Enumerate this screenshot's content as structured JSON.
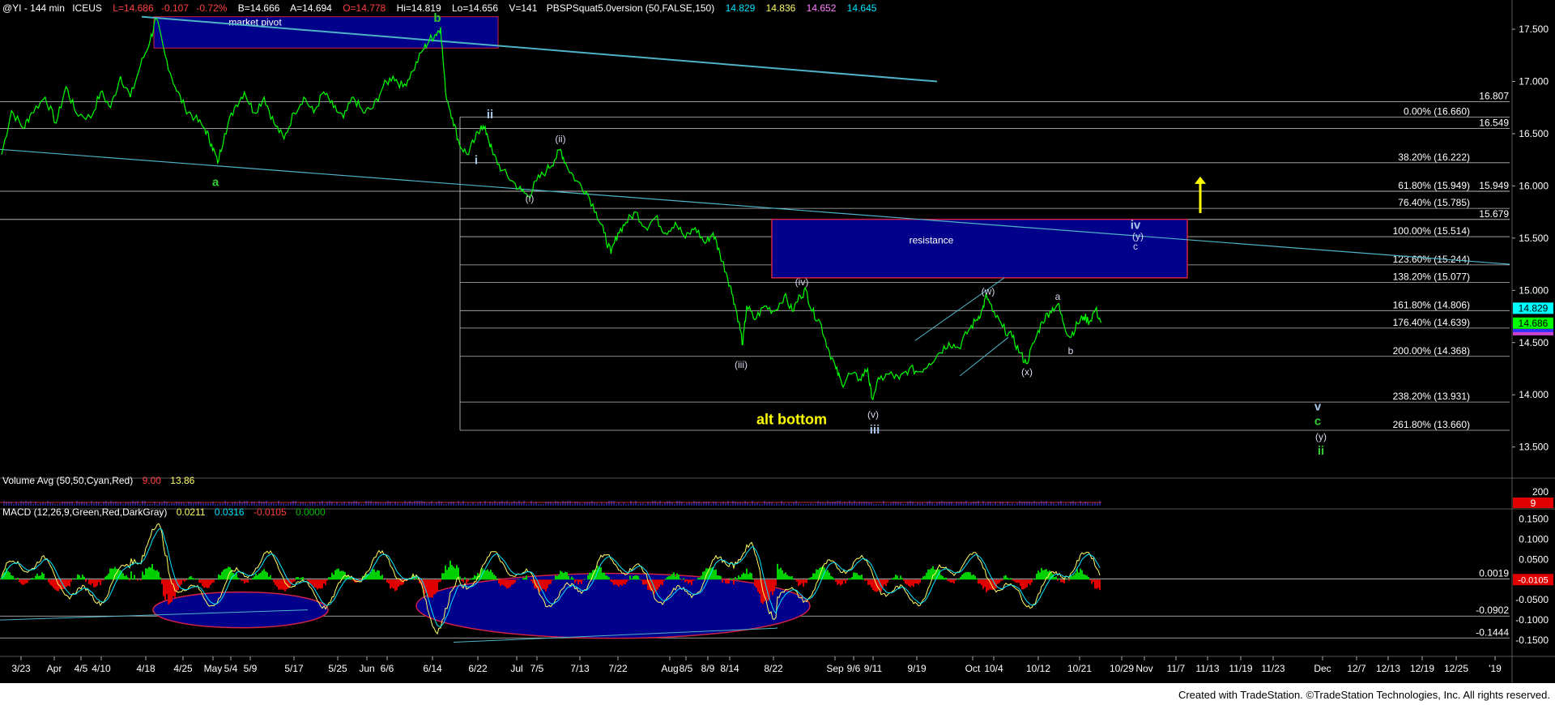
{
  "header": {
    "symbol": "@YI - 144 min",
    "exchange": "ICEUS",
    "last": "L=14.686",
    "change": "-0.107",
    "change_pct": "-0.72%",
    "bid": "B=14.666",
    "ask": "A=14.694",
    "open": "O=14.778",
    "high": "Hi=14.819",
    "low": "Lo=14.656",
    "volume": "V=141",
    "study": "PBSPSquat5.0version (50,FALSE,150)",
    "study_values": [
      "14.829",
      "14.836",
      "14.652",
      "14.645"
    ]
  },
  "colors": {
    "background": "#000000",
    "price": "#00ff00",
    "cyan_line": "#4fb3c8",
    "box_fill": "#00008b",
    "yellow": "#ffff00",
    "wave_green": "#33cc33",
    "wave_white": "#d8d8f0",
    "wave_lightblue": "#a8c8e8"
  },
  "volume_panel": {
    "title": "Volume Avg (50,50,Cyan,Red)",
    "value1": "9.00",
    "value2": "13.86",
    "axis_labels": [
      "200",
      "9"
    ]
  },
  "macd_panel": {
    "title": "MACD (12,26,9,Green,Red,DarkGray)",
    "values": [
      "0.0211",
      "0.0316",
      "-0.0105",
      "0.0000"
    ],
    "axis_ticks": [
      "0.1500",
      "0.1000",
      "0.0500",
      "-0.0500",
      "-0.1000",
      "-0.1500"
    ],
    "levels": [
      "0.0019",
      "-0.0902",
      "-0.1444"
    ],
    "last_value": "-0.0105"
  },
  "footer_text": "Created with TradeStation. ©TradeStation Technologies, Inc. All rights reserved.",
  "chart_data": {
    "type": "line",
    "title": "@YI - 144 min",
    "x_tick_labels": [
      "3/23",
      "Apr",
      "4/5",
      "4/10",
      "4/18",
      "4/25",
      "May",
      "5/4",
      "5/9",
      "5/17",
      "5/25",
      "Jun",
      "6/6",
      "6/14",
      "6/22",
      "Jul",
      "7/5",
      "7/13",
      "7/22",
      "Aug",
      "8/5",
      "8/9",
      "8/14",
      "8/22",
      "Sep",
      "9/6",
      "9/11",
      "9/19",
      "Oct",
      "10/4",
      "10/12",
      "10/21",
      "10/29",
      "Nov",
      "11/7",
      "11/13",
      "11/19",
      "11/23",
      "Dec",
      "12/7",
      "12/13",
      "12/19",
      "12/25",
      "'19"
    ],
    "y_ticks": [
      17.5,
      17.0,
      16.5,
      16.0,
      15.5,
      15.0,
      14.5,
      14.0,
      13.5
    ],
    "ylim": [
      13.28,
      17.78
    ],
    "price_series": {
      "name": "Price",
      "points": [
        [
          0,
          16.3
        ],
        [
          10,
          16.72
        ],
        [
          22,
          16.55
        ],
        [
          30,
          16.7
        ],
        [
          44,
          16.85
        ],
        [
          55,
          16.6
        ],
        [
          65,
          16.95
        ],
        [
          75,
          16.7
        ],
        [
          90,
          16.65
        ],
        [
          100,
          16.9
        ],
        [
          110,
          16.75
        ],
        [
          120,
          17.05
        ],
        [
          130,
          16.85
        ],
        [
          140,
          17.15
        ],
        [
          150,
          17.4
        ],
        [
          156,
          17.6
        ],
        [
          165,
          17.25
        ],
        [
          175,
          16.95
        ],
        [
          185,
          16.75
        ],
        [
          195,
          16.65
        ],
        [
          205,
          16.55
        ],
        [
          212,
          16.4
        ],
        [
          218,
          16.22
        ],
        [
          225,
          16.5
        ],
        [
          235,
          16.75
        ],
        [
          245,
          16.9
        ],
        [
          255,
          16.7
        ],
        [
          265,
          16.85
        ],
        [
          275,
          16.6
        ],
        [
          285,
          16.45
        ],
        [
          295,
          16.7
        ],
        [
          305,
          16.85
        ],
        [
          315,
          16.7
        ],
        [
          325,
          16.9
        ],
        [
          335,
          16.75
        ],
        [
          345,
          16.65
        ],
        [
          355,
          16.85
        ],
        [
          365,
          16.7
        ],
        [
          375,
          16.75
        ],
        [
          385,
          16.95
        ],
        [
          395,
          17.05
        ],
        [
          405,
          16.95
        ],
        [
          415,
          17.1
        ],
        [
          425,
          17.3
        ],
        [
          432,
          17.4
        ],
        [
          438,
          17.45
        ],
        [
          443,
          17.52
        ],
        [
          448,
          16.9
        ],
        [
          455,
          16.65
        ],
        [
          462,
          16.4
        ],
        [
          470,
          16.3
        ],
        [
          478,
          16.45
        ],
        [
          484,
          16.58
        ],
        [
          490,
          16.5
        ],
        [
          496,
          16.3
        ],
        [
          505,
          16.15
        ],
        [
          515,
          16.05
        ],
        [
          525,
          15.95
        ],
        [
          532,
          15.9
        ],
        [
          540,
          16.05
        ],
        [
          550,
          16.15
        ],
        [
          558,
          16.25
        ],
        [
          564,
          16.35
        ],
        [
          570,
          16.2
        ],
        [
          580,
          16.05
        ],
        [
          590,
          15.95
        ],
        [
          600,
          15.75
        ],
        [
          608,
          15.55
        ],
        [
          615,
          15.35
        ],
        [
          622,
          15.55
        ],
        [
          630,
          15.65
        ],
        [
          640,
          15.75
        ],
        [
          650,
          15.6
        ],
        [
          660,
          15.7
        ],
        [
          670,
          15.55
        ],
        [
          680,
          15.65
        ],
        [
          690,
          15.5
        ],
        [
          700,
          15.6
        ],
        [
          710,
          15.45
        ],
        [
          718,
          15.55
        ],
        [
          725,
          15.35
        ],
        [
          732,
          15.15
        ],
        [
          738,
          14.95
        ],
        [
          744,
          14.7
        ],
        [
          748,
          14.48
        ],
        [
          752,
          14.85
        ],
        [
          760,
          14.72
        ],
        [
          770,
          14.85
        ],
        [
          780,
          14.8
        ],
        [
          790,
          14.95
        ],
        [
          798,
          14.8
        ],
        [
          806,
          14.95
        ],
        [
          812,
          15.0
        ],
        [
          818,
          14.8
        ],
        [
          826,
          14.7
        ],
        [
          834,
          14.45
        ],
        [
          842,
          14.25
        ],
        [
          848,
          14.1
        ],
        [
          856,
          14.2
        ],
        [
          866,
          14.15
        ],
        [
          874,
          14.25
        ],
        [
          878,
          13.97
        ],
        [
          886,
          14.15
        ],
        [
          896,
          14.2
        ],
        [
          906,
          14.15
        ],
        [
          916,
          14.25
        ],
        [
          926,
          14.22
        ],
        [
          936,
          14.3
        ],
        [
          946,
          14.4
        ],
        [
          956,
          14.5
        ],
        [
          966,
          14.45
        ],
        [
          976,
          14.62
        ],
        [
          984,
          14.72
        ],
        [
          990,
          14.82
        ],
        [
          994,
          14.95
        ],
        [
          1000,
          14.8
        ],
        [
          1010,
          14.65
        ],
        [
          1020,
          14.55
        ],
        [
          1028,
          14.4
        ],
        [
          1034,
          14.3
        ],
        [
          1042,
          14.5
        ],
        [
          1050,
          14.7
        ],
        [
          1058,
          14.8
        ],
        [
          1066,
          14.87
        ],
        [
          1072,
          14.68
        ],
        [
          1078,
          14.55
        ],
        [
          1086,
          14.68
        ],
        [
          1092,
          14.75
        ],
        [
          1098,
          14.7
        ],
        [
          1104,
          14.82
        ],
        [
          1110,
          14.69
        ]
      ]
    },
    "fib_levels": [
      {
        "label": "0.00% (16.660)",
        "value": 16.66
      },
      {
        "label": "38.20% (16.222)",
        "value": 16.222
      },
      {
        "label": "61.80% (15.949)",
        "value": 15.949
      },
      {
        "label": "76.40% (15.785)",
        "value": 15.785
      },
      {
        "label": "100.00% (15.514)",
        "value": 15.514
      },
      {
        "label": "123.60% (15.244)",
        "value": 15.244
      },
      {
        "label": "138.20% (15.077)",
        "value": 15.077
      },
      {
        "label": "161.80% (14.806)",
        "value": 14.806
      },
      {
        "label": "176.40% (14.639)",
        "value": 14.639
      },
      {
        "label": "200.00% (14.368)",
        "value": 14.368
      },
      {
        "label": "238.20% (13.931)",
        "value": 13.931
      },
      {
        "label": "261.80% (13.660)",
        "value": 13.66
      }
    ],
    "horizontal_levels": [
      {
        "label": "16.807",
        "value": 16.807
      },
      {
        "label": "16.549",
        "value": 16.549
      },
      {
        "label": "15.949",
        "value": 15.949
      },
      {
        "label": "15.679",
        "value": 15.679
      }
    ],
    "price_markers": [
      {
        "label": "14.829",
        "value": 14.829,
        "color": "#00ffff"
      },
      {
        "label": "14.686",
        "value": 14.686,
        "color": "#00ff00"
      }
    ],
    "zones": [
      {
        "label": "market pivot",
        "y_top": 17.62,
        "y_bottom": 17.32
      },
      {
        "label": "resistance",
        "y_top": 15.68,
        "y_bottom": 15.12
      }
    ],
    "wave_labels": [
      {
        "text": "a",
        "color": "green",
        "value": 16.03
      },
      {
        "text": "b",
        "color": "green",
        "value": 17.6
      },
      {
        "text": "ii",
        "color": "lightblue",
        "value": 16.68
      },
      {
        "text": "i",
        "color": "lightblue",
        "value": 16.24
      },
      {
        "text": "(ii)",
        "color": "white",
        "value": 16.45
      },
      {
        "text": "(i)",
        "color": "white",
        "value": 15.88
      },
      {
        "text": "(iv)",
        "color": "white",
        "value": 15.08
      },
      {
        "text": "(iii)",
        "color": "white",
        "value": 14.29
      },
      {
        "text": "(v)",
        "color": "white",
        "value": 13.81
      },
      {
        "text": "iii",
        "color": "lightblue",
        "value": 13.66
      },
      {
        "text": "(w)",
        "color": "white",
        "value": 14.99
      },
      {
        "text": "(x)",
        "color": "white",
        "value": 14.22
      },
      {
        "text": "a",
        "color": "white",
        "value": 14.94
      },
      {
        "text": "b",
        "color": "white",
        "value": 14.42
      },
      {
        "text": "iv",
        "color": "lightblue",
        "value": 15.62
      },
      {
        "text": "(y)",
        "color": "white",
        "value": 15.52
      },
      {
        "text": "c",
        "color": "white",
        "value": 15.42
      },
      {
        "text": "v",
        "color": "lightblue",
        "value": 13.88
      },
      {
        "text": "c",
        "color": "green",
        "value": 13.74
      },
      {
        "text": "(y)",
        "color": "white",
        "value": 13.6
      },
      {
        "text": "ii",
        "color": "green",
        "value": 13.46
      }
    ],
    "annotations": [
      {
        "text": "alt bottom",
        "color": "#ffff00"
      }
    ],
    "arrow": {
      "direction": "up",
      "color": "#ffff00"
    }
  }
}
